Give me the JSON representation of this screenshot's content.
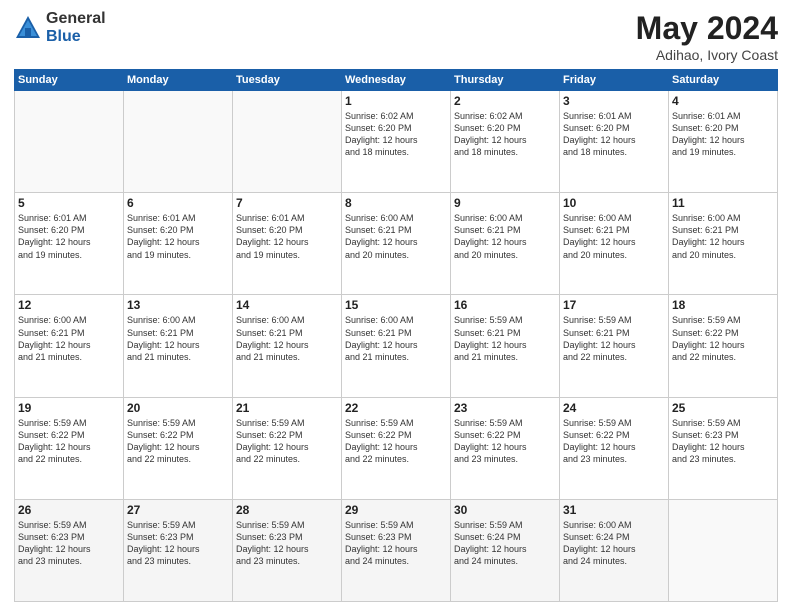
{
  "logo": {
    "general": "General",
    "blue": "Blue"
  },
  "header": {
    "month": "May 2024",
    "location": "Adihao, Ivory Coast"
  },
  "weekdays": [
    "Sunday",
    "Monday",
    "Tuesday",
    "Wednesday",
    "Thursday",
    "Friday",
    "Saturday"
  ],
  "weeks": [
    [
      {
        "day": "",
        "info": ""
      },
      {
        "day": "",
        "info": ""
      },
      {
        "day": "",
        "info": ""
      },
      {
        "day": "1",
        "info": "Sunrise: 6:02 AM\nSunset: 6:20 PM\nDaylight: 12 hours\nand 18 minutes."
      },
      {
        "day": "2",
        "info": "Sunrise: 6:02 AM\nSunset: 6:20 PM\nDaylight: 12 hours\nand 18 minutes."
      },
      {
        "day": "3",
        "info": "Sunrise: 6:01 AM\nSunset: 6:20 PM\nDaylight: 12 hours\nand 18 minutes."
      },
      {
        "day": "4",
        "info": "Sunrise: 6:01 AM\nSunset: 6:20 PM\nDaylight: 12 hours\nand 19 minutes."
      }
    ],
    [
      {
        "day": "5",
        "info": "Sunrise: 6:01 AM\nSunset: 6:20 PM\nDaylight: 12 hours\nand 19 minutes."
      },
      {
        "day": "6",
        "info": "Sunrise: 6:01 AM\nSunset: 6:20 PM\nDaylight: 12 hours\nand 19 minutes."
      },
      {
        "day": "7",
        "info": "Sunrise: 6:01 AM\nSunset: 6:20 PM\nDaylight: 12 hours\nand 19 minutes."
      },
      {
        "day": "8",
        "info": "Sunrise: 6:00 AM\nSunset: 6:21 PM\nDaylight: 12 hours\nand 20 minutes."
      },
      {
        "day": "9",
        "info": "Sunrise: 6:00 AM\nSunset: 6:21 PM\nDaylight: 12 hours\nand 20 minutes."
      },
      {
        "day": "10",
        "info": "Sunrise: 6:00 AM\nSunset: 6:21 PM\nDaylight: 12 hours\nand 20 minutes."
      },
      {
        "day": "11",
        "info": "Sunrise: 6:00 AM\nSunset: 6:21 PM\nDaylight: 12 hours\nand 20 minutes."
      }
    ],
    [
      {
        "day": "12",
        "info": "Sunrise: 6:00 AM\nSunset: 6:21 PM\nDaylight: 12 hours\nand 21 minutes."
      },
      {
        "day": "13",
        "info": "Sunrise: 6:00 AM\nSunset: 6:21 PM\nDaylight: 12 hours\nand 21 minutes."
      },
      {
        "day": "14",
        "info": "Sunrise: 6:00 AM\nSunset: 6:21 PM\nDaylight: 12 hours\nand 21 minutes."
      },
      {
        "day": "15",
        "info": "Sunrise: 6:00 AM\nSunset: 6:21 PM\nDaylight: 12 hours\nand 21 minutes."
      },
      {
        "day": "16",
        "info": "Sunrise: 5:59 AM\nSunset: 6:21 PM\nDaylight: 12 hours\nand 21 minutes."
      },
      {
        "day": "17",
        "info": "Sunrise: 5:59 AM\nSunset: 6:21 PM\nDaylight: 12 hours\nand 22 minutes."
      },
      {
        "day": "18",
        "info": "Sunrise: 5:59 AM\nSunset: 6:22 PM\nDaylight: 12 hours\nand 22 minutes."
      }
    ],
    [
      {
        "day": "19",
        "info": "Sunrise: 5:59 AM\nSunset: 6:22 PM\nDaylight: 12 hours\nand 22 minutes."
      },
      {
        "day": "20",
        "info": "Sunrise: 5:59 AM\nSunset: 6:22 PM\nDaylight: 12 hours\nand 22 minutes."
      },
      {
        "day": "21",
        "info": "Sunrise: 5:59 AM\nSunset: 6:22 PM\nDaylight: 12 hours\nand 22 minutes."
      },
      {
        "day": "22",
        "info": "Sunrise: 5:59 AM\nSunset: 6:22 PM\nDaylight: 12 hours\nand 22 minutes."
      },
      {
        "day": "23",
        "info": "Sunrise: 5:59 AM\nSunset: 6:22 PM\nDaylight: 12 hours\nand 23 minutes."
      },
      {
        "day": "24",
        "info": "Sunrise: 5:59 AM\nSunset: 6:22 PM\nDaylight: 12 hours\nand 23 minutes."
      },
      {
        "day": "25",
        "info": "Sunrise: 5:59 AM\nSunset: 6:23 PM\nDaylight: 12 hours\nand 23 minutes."
      }
    ],
    [
      {
        "day": "26",
        "info": "Sunrise: 5:59 AM\nSunset: 6:23 PM\nDaylight: 12 hours\nand 23 minutes."
      },
      {
        "day": "27",
        "info": "Sunrise: 5:59 AM\nSunset: 6:23 PM\nDaylight: 12 hours\nand 23 minutes."
      },
      {
        "day": "28",
        "info": "Sunrise: 5:59 AM\nSunset: 6:23 PM\nDaylight: 12 hours\nand 23 minutes."
      },
      {
        "day": "29",
        "info": "Sunrise: 5:59 AM\nSunset: 6:23 PM\nDaylight: 12 hours\nand 24 minutes."
      },
      {
        "day": "30",
        "info": "Sunrise: 5:59 AM\nSunset: 6:24 PM\nDaylight: 12 hours\nand 24 minutes."
      },
      {
        "day": "31",
        "info": "Sunrise: 6:00 AM\nSunset: 6:24 PM\nDaylight: 12 hours\nand 24 minutes."
      },
      {
        "day": "",
        "info": ""
      }
    ]
  ]
}
